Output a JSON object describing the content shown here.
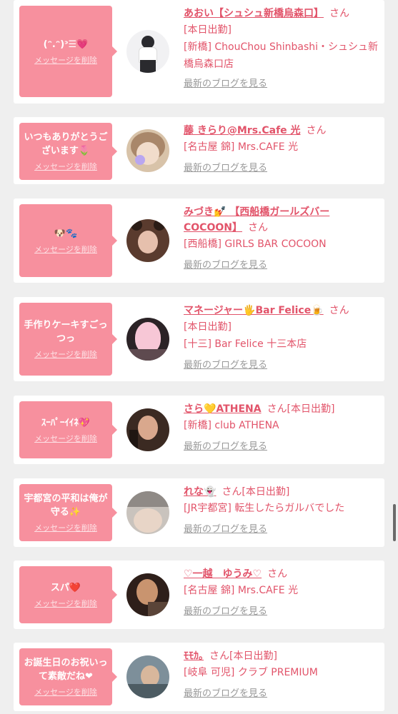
{
  "messages": [
    {
      "text": "(ᵔ.ᵔ)ᵓ☰💗",
      "delete_label": "メッセージを削除",
      "name": "あおい【シュシュ新橋烏森口】",
      "suffix": "さん",
      "lines": [
        "[本日出勤]",
        "[新橋] ChouChou Shinbashi・シュシュ新橋烏森口店"
      ],
      "blog_label": "最新のブログを見る",
      "avatar_colors": [
        "#f1f1f3",
        "#2a2a2e"
      ]
    },
    {
      "text": "いつもありがとうございます🌷",
      "delete_label": "メッセージを削除",
      "name": "藤 きらり@Mrs.Cafe 光",
      "suffix": "さん",
      "lines": [
        "[名古屋 錦] Mrs.CAFE 光"
      ],
      "blog_label": "最新のブログを見る",
      "avatar_colors": [
        "#d8c3a9",
        "#a9876a"
      ]
    },
    {
      "text": "🐶🐾",
      "delete_label": "メッセージを削除",
      "name": "みづき💅 【西船橋ガールズバーCOCOON】",
      "suffix": "さん",
      "lines": [
        "[西船橋] GIRLS BAR COCOON"
      ],
      "blog_label": "最新のブログを見る",
      "avatar_colors": [
        "#5a3b2e",
        "#e6c0ad"
      ]
    },
    {
      "text": "手作りケーキすごっつっ",
      "delete_label": "メッセージを削除",
      "name": "マネージャー🖐Bar Felice🍺",
      "suffix": "さん",
      "lines": [
        "[本日出勤]",
        "[十三] Bar Felice 十三本店"
      ],
      "blog_label": "最新のブログを見る",
      "avatar_colors": [
        "#2b2326",
        "#f7c7d6"
      ]
    },
    {
      "text": "ｽｰﾊﾟｰｲｲﾈ💖",
      "delete_label": "メッセージを削除",
      "name": "さら💛ATHENA",
      "suffix": "さん[本日出勤]",
      "lines": [
        "[新橋] club ATHENA"
      ],
      "blog_label": "最新のブログを見る",
      "avatar_colors": [
        "#3b2a22",
        "#d9a88d"
      ]
    },
    {
      "text": "宇都宮の平和は俺が守る✨",
      "delete_label": "メッセージを削除",
      "name": "れな👻",
      "suffix": "さん[本日出勤]",
      "lines": [
        "[JR宇都宮] 転生したらガルバでした"
      ],
      "blog_label": "最新のブログを見る",
      "avatar_colors": [
        "#c9c3bd",
        "#e8d5c7"
      ]
    },
    {
      "text": "スパ❤️",
      "delete_label": "メッセージを削除",
      "name": "♡一越　ゆうみ♡",
      "suffix": "さん",
      "lines": [
        "[名古屋 錦] Mrs.CAFE 光"
      ],
      "blog_label": "最新のブログを見る",
      "avatar_colors": [
        "#2e1f1a",
        "#c9946f"
      ]
    },
    {
      "text": "お誕生日のお祝いって素敵だね❤",
      "delete_label": "メッセージを削除",
      "name": "ﾓﾓｶ｡",
      "suffix": "さん[本日出勤]",
      "lines": [
        "[岐阜 可児] クラブ PREMIUM"
      ],
      "blog_label": "最新のブログを見る",
      "avatar_colors": [
        "#7d8f9a",
        "#d8b79c"
      ]
    }
  ]
}
